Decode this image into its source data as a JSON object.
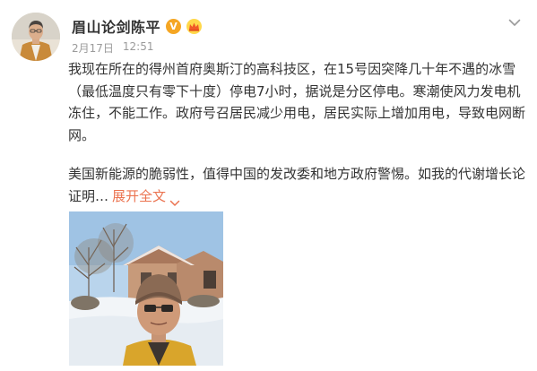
{
  "post": {
    "username": "眉山论剑陈平",
    "verified_mark": "V",
    "date": "2月17日",
    "time": "12:51",
    "paragraph_1": "我现在所在的得州首府奥斯汀的高科技区，在15号因突降几十年不遇的冰雪（最低温度只有零下十度）停电7小时，据说是分区停电。寒潮使风力发电机冻住，不能工作。政府号召居民减少用电，居民实际上增加用电，导致电网断网。",
    "paragraph_2": "美国新能源的脆弱性，值得中国的发改委和地方政府警惕。如我的代谢增长论证明…",
    "expand_label": "展开全文",
    "icons": {
      "menu": "chevron-down-icon",
      "verified": "verified-v-icon",
      "member": "member-crown-icon",
      "expand": "chevron-down-icon"
    }
  },
  "colors": {
    "accent_link": "#eb7350",
    "verified_badge": "#f5a623",
    "meta_text": "#9b9b9b",
    "body_text": "#333333"
  }
}
